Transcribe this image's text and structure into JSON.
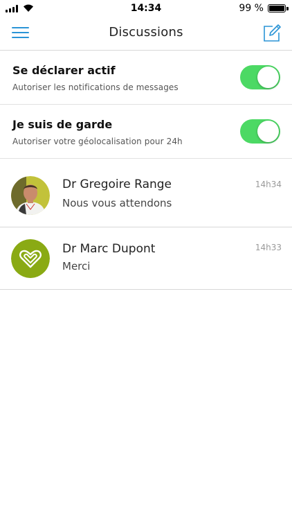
{
  "status_bar": {
    "time": "14:34",
    "battery_percent": "99 %"
  },
  "nav": {
    "title": "Discussions",
    "menu_icon": "hamburger-menu-icon",
    "compose_icon": "compose-icon"
  },
  "settings": [
    {
      "title": "Se déclarer actif",
      "subtitle": "Autoriser les notifications de messages",
      "enabled": true
    },
    {
      "title": "Je suis de garde",
      "subtitle": "Autoriser votre géolocalisation pour 24h",
      "enabled": true
    }
  ],
  "conversations": [
    {
      "name": "Dr Gregoire Range",
      "last_message": "Nous vous attendons",
      "time": "14h34",
      "avatar": "doctor-photo"
    },
    {
      "name": "Dr Marc Dupont",
      "last_message": "Merci",
      "time": "14h33",
      "avatar": "heart-logo-icon"
    }
  ],
  "colors": {
    "accent": "#2a94d6",
    "toggle_on": "#4cd964",
    "logo_green": "#8aaa14"
  }
}
